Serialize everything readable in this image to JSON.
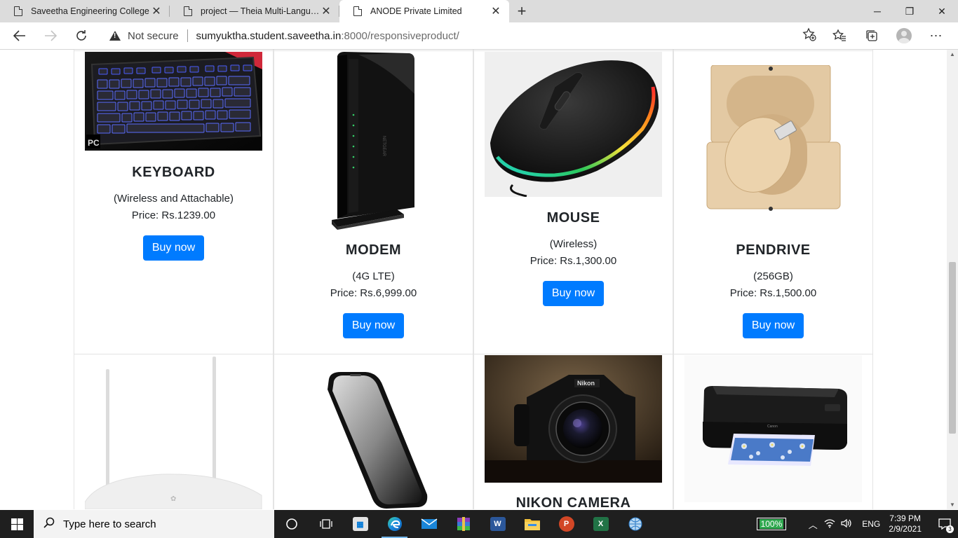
{
  "browser": {
    "tabs": [
      {
        "title": "Saveetha Engineering College",
        "active": false
      },
      {
        "title": "project — Theia Multi-Language",
        "active": false
      },
      {
        "title": "ANODE Private Limited",
        "active": true
      }
    ],
    "new_tab_symbol": "+",
    "window_controls": {
      "minimize": "─",
      "restore": "❐",
      "close": "✕"
    },
    "security_label": "Not secure",
    "url_host": "sumyuktha.student.saveetha.in",
    "url_rest": ":8000/responsiveproduct/"
  },
  "products": [
    {
      "name": "KEYBOARD",
      "subtitle": "(Wireless and Attachable)",
      "price": "Price: Rs.1239.00",
      "button": "Buy now",
      "image": "keyboard-image"
    },
    {
      "name": "MODEM",
      "subtitle": "(4G LTE)",
      "price": "Price: Rs.6,999.00",
      "button": "Buy now",
      "image": "modem-image"
    },
    {
      "name": "MOUSE",
      "subtitle": "(Wireless)",
      "price": "Price: Rs.1,300.00",
      "button": "Buy now",
      "image": "mouse-image"
    },
    {
      "name": "PENDRIVE",
      "subtitle": "(256GB)",
      "price": "Price: Rs.1,500.00",
      "button": "Buy now",
      "image": "pendrive-image"
    },
    {
      "name": "",
      "image": "router-image"
    },
    {
      "name": "",
      "image": "phone-screen-guard-image"
    },
    {
      "name": "NIKON CAMERA",
      "image": "camera-image"
    },
    {
      "name": "",
      "image": "printer-image"
    }
  ],
  "taskbar": {
    "search_placeholder": "Type here to search",
    "battery": "100%",
    "language": "ENG",
    "time": "7:39 PM",
    "date": "2/9/2021",
    "notification_count": "3"
  },
  "colors": {
    "button": "#007bff",
    "tab_strip": "#dcdcdc",
    "taskbar": "#1f1f1f"
  }
}
